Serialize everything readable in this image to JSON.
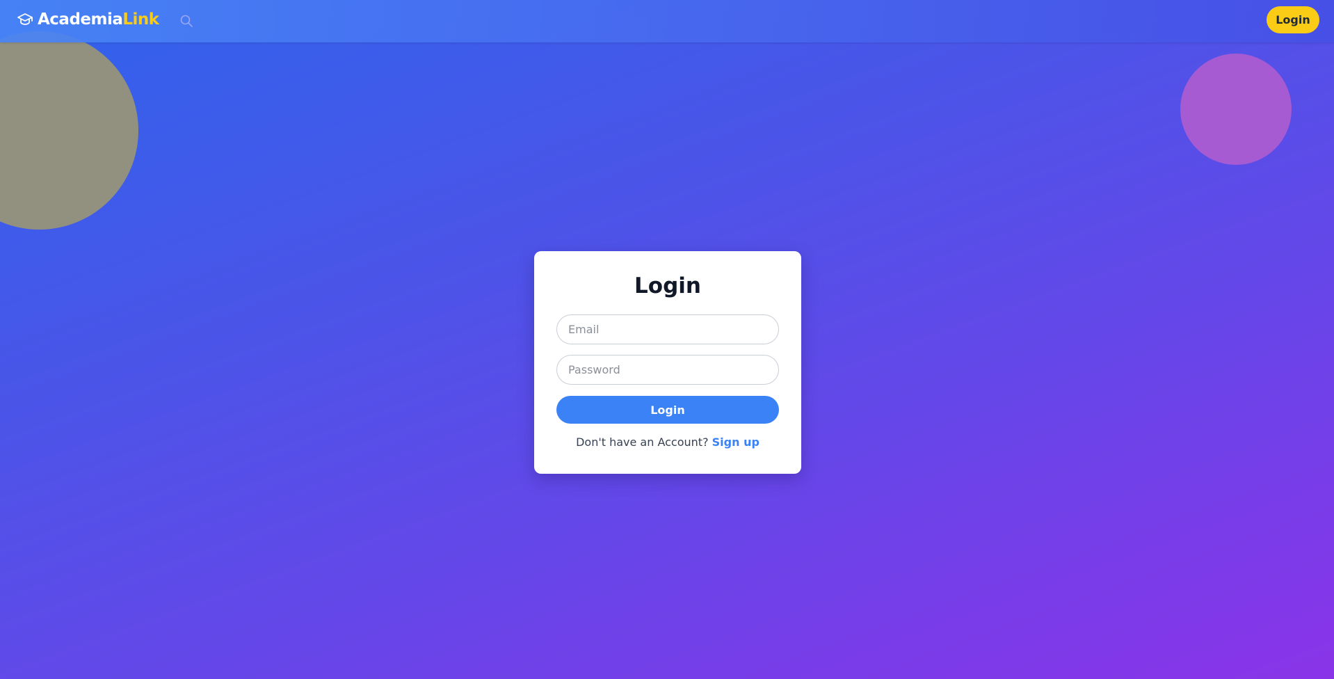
{
  "navbar": {
    "brand_part1": "Academia",
    "brand_part2": "Link",
    "login_label": "Login"
  },
  "icons": {
    "brand": "graduation-cap-icon",
    "search": "search-icon"
  },
  "login_card": {
    "title": "Login",
    "email_placeholder": "Email",
    "password_placeholder": "Password",
    "submit_label": "Login",
    "signup_prompt": "Don't have an Account?",
    "signup_link": "Sign up"
  },
  "colors": {
    "accent": "#3b82f6",
    "highlight": "#facc15",
    "bg_start": "#2f63ec",
    "bg_end": "#8a34e8"
  }
}
